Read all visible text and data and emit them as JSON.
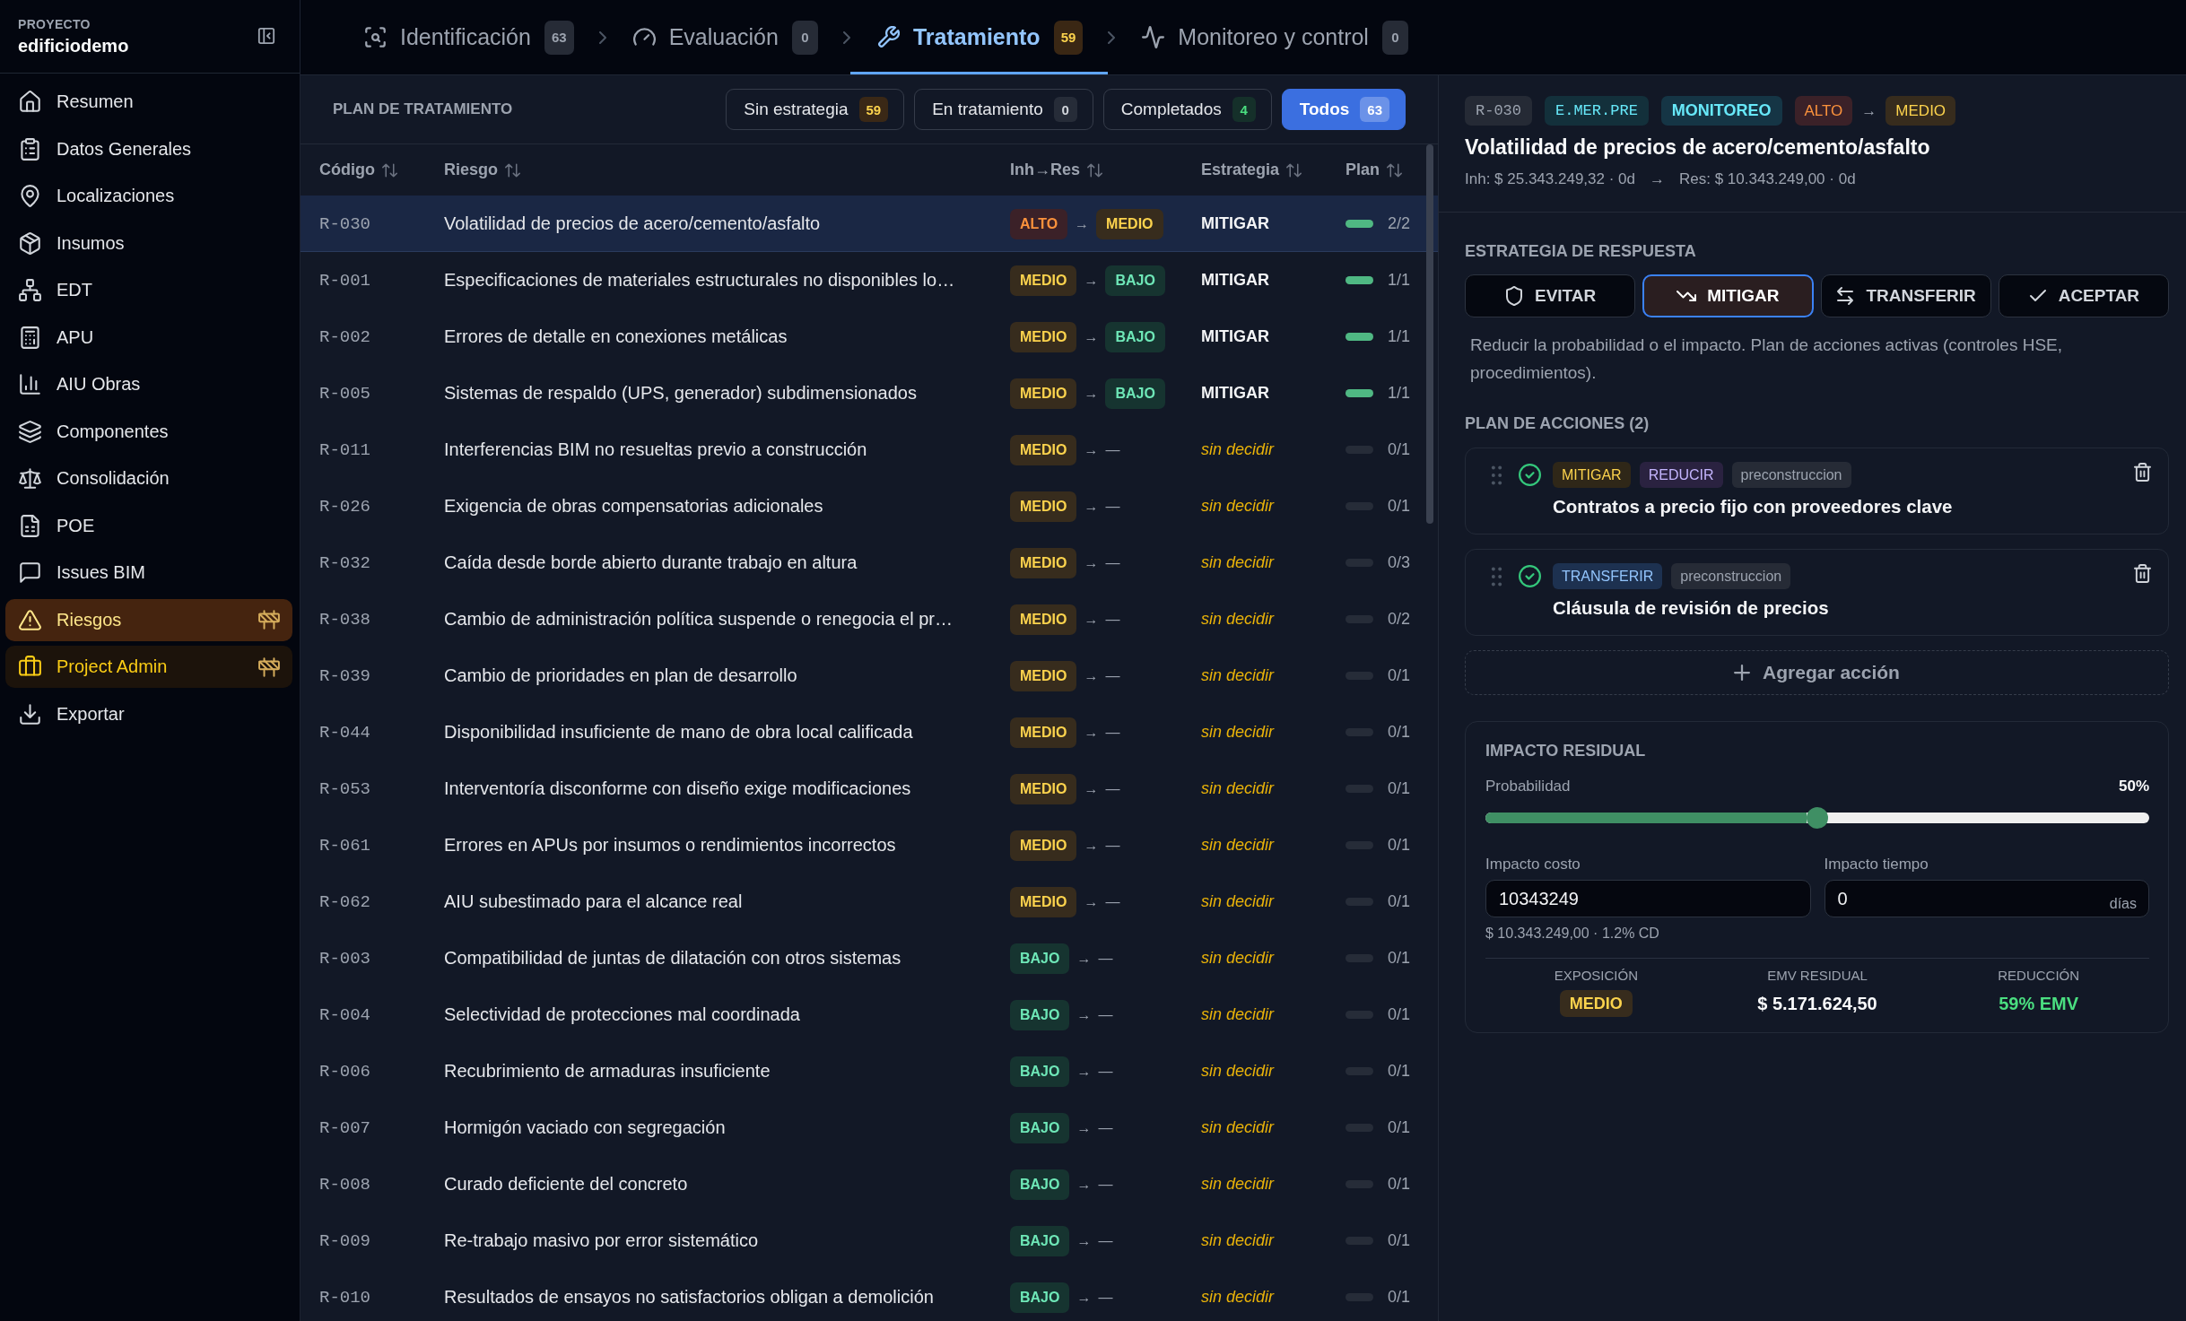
{
  "sidebar": {
    "project_label": "PROYECTO",
    "project_name": "edificiodemo",
    "items": [
      {
        "label": "Resumen",
        "kind": "nav",
        "selected": false,
        "wip": false
      },
      {
        "label": "Datos Generales",
        "kind": "nav",
        "selected": false,
        "wip": false
      },
      {
        "label": "Localizaciones",
        "kind": "nav",
        "selected": false,
        "wip": false
      },
      {
        "label": "Insumos",
        "kind": "nav",
        "selected": false,
        "wip": false
      },
      {
        "label": "EDT",
        "kind": "nav",
        "selected": false,
        "wip": false
      },
      {
        "label": "APU",
        "kind": "nav",
        "selected": false,
        "wip": false
      },
      {
        "label": "AIU Obras",
        "kind": "nav",
        "selected": false,
        "wip": false
      },
      {
        "label": "Componentes",
        "kind": "nav",
        "selected": false,
        "wip": false
      },
      {
        "label": "Consolidación",
        "kind": "nav",
        "selected": false,
        "wip": false
      },
      {
        "label": "POE",
        "kind": "nav",
        "selected": false,
        "wip": false
      },
      {
        "label": "Issues BIM",
        "kind": "nav",
        "selected": false,
        "wip": false
      },
      {
        "label": "Riesgos",
        "kind": "nav",
        "selected": true,
        "wip": true
      },
      {
        "label": "Project Admin",
        "kind": "admin",
        "selected": false,
        "wip": true
      },
      {
        "label": "Exportar",
        "kind": "nav",
        "selected": false,
        "wip": false
      }
    ]
  },
  "tabs": [
    {
      "label": "Identificación",
      "count": "63",
      "selected": false
    },
    {
      "label": "Evaluación",
      "count": "0",
      "selected": false
    },
    {
      "label": "Tratamiento",
      "count": "59",
      "selected": true
    },
    {
      "label": "Monitoreo y control",
      "count": "0",
      "selected": false
    }
  ],
  "plan": {
    "title": "PLAN DE TRATAMIENTO",
    "filters": [
      {
        "label": "Sin estrategia",
        "count": "59",
        "kind": "warning",
        "selected": false
      },
      {
        "label": "En tratamiento",
        "count": "0",
        "kind": "neutral",
        "selected": false
      },
      {
        "label": "Completados",
        "count": "4",
        "kind": "success",
        "selected": false
      },
      {
        "label": "Todos",
        "count": "63",
        "kind": "neutral",
        "selected": true
      }
    ]
  },
  "table": {
    "columns": [
      "Código",
      "Riesgo",
      "Inh→Res",
      "Estrategia",
      "Plan"
    ],
    "rows": [
      {
        "code": "R-030",
        "risk": "Volatilidad de precios de acero/cemento/asfalto",
        "inherent": {
          "label": "ALTO",
          "kind": "high"
        },
        "arrow": "→",
        "residual": {
          "label": "MEDIO",
          "kind": "medium"
        },
        "strategy": {
          "label": "MITIGAR",
          "pending": false
        },
        "plan": {
          "progress": "2/2",
          "level": 1
        },
        "selected": true
      },
      {
        "code": "R-001",
        "risk": "Especificaciones de materiales estructurales no disponibles lo…",
        "inherent": {
          "label": "MEDIO",
          "kind": "medium"
        },
        "arrow": "→",
        "residual": {
          "label": "BAJO",
          "kind": "low"
        },
        "strategy": {
          "label": "MITIGAR",
          "pending": false
        },
        "plan": {
          "progress": "1/1",
          "level": 1
        },
        "selected": false
      },
      {
        "code": "R-002",
        "risk": "Errores de detalle en conexiones metálicas",
        "inherent": {
          "label": "MEDIO",
          "kind": "medium"
        },
        "arrow": "→",
        "residual": {
          "label": "BAJO",
          "kind": "low"
        },
        "strategy": {
          "label": "MITIGAR",
          "pending": false
        },
        "plan": {
          "progress": "1/1",
          "level": 1
        },
        "selected": false
      },
      {
        "code": "R-005",
        "risk": "Sistemas de respaldo (UPS, generador) subdimensionados",
        "inherent": {
          "label": "MEDIO",
          "kind": "medium"
        },
        "arrow": "→",
        "residual": {
          "label": "BAJO",
          "kind": "low"
        },
        "strategy": {
          "label": "MITIGAR",
          "pending": false
        },
        "plan": {
          "progress": "1/1",
          "level": 1
        },
        "selected": false
      },
      {
        "code": "R-011",
        "risk": "Interferencias BIM no resueltas previo a construcción",
        "inherent": {
          "label": "MEDIO",
          "kind": "medium"
        },
        "arrow": "→",
        "residual": {
          "label": "—",
          "kind": "none"
        },
        "strategy": {
          "label": "sin decidir",
          "pending": true
        },
        "plan": {
          "progress": "0/1"
        },
        "selected": false
      },
      {
        "code": "R-026",
        "risk": "Exigencia de obras compensatorias adicionales",
        "inherent": {
          "label": "MEDIO",
          "kind": "medium"
        },
        "arrow": "→",
        "residual": {
          "label": "—",
          "kind": "none"
        },
        "strategy": {
          "label": "sin decidir",
          "pending": true
        },
        "plan": {
          "progress": "0/1"
        },
        "selected": false
      },
      {
        "code": "R-032",
        "risk": "Caída desde borde abierto durante trabajo en altura",
        "inherent": {
          "label": "MEDIO",
          "kind": "medium"
        },
        "arrow": "→",
        "residual": {
          "label": "—",
          "kind": "none"
        },
        "strategy": {
          "label": "sin decidir",
          "pending": true
        },
        "plan": {
          "progress": "0/3"
        },
        "selected": false
      },
      {
        "code": "R-038",
        "risk": "Cambio de administración política suspende o renegocia el pr…",
        "inherent": {
          "label": "MEDIO",
          "kind": "medium"
        },
        "arrow": "→",
        "residual": {
          "label": "—",
          "kind": "none"
        },
        "strategy": {
          "label": "sin decidir",
          "pending": true
        },
        "plan": {
          "progress": "0/2"
        },
        "selected": false
      },
      {
        "code": "R-039",
        "risk": "Cambio de prioridades en plan de desarrollo",
        "inherent": {
          "label": "MEDIO",
          "kind": "medium"
        },
        "arrow": "→",
        "residual": {
          "label": "—",
          "kind": "none"
        },
        "strategy": {
          "label": "sin decidir",
          "pending": true
        },
        "plan": {
          "progress": "0/1"
        },
        "selected": false
      },
      {
        "code": "R-044",
        "risk": "Disponibilidad insuficiente de mano de obra local calificada",
        "inherent": {
          "label": "MEDIO",
          "kind": "medium"
        },
        "arrow": "→",
        "residual": {
          "label": "—",
          "kind": "none"
        },
        "strategy": {
          "label": "sin decidir",
          "pending": true
        },
        "plan": {
          "progress": "0/1"
        },
        "selected": false
      },
      {
        "code": "R-053",
        "risk": "Interventoría disconforme con diseño exige modificaciones",
        "inherent": {
          "label": "MEDIO",
          "kind": "medium"
        },
        "arrow": "→",
        "residual": {
          "label": "—",
          "kind": "none"
        },
        "strategy": {
          "label": "sin decidir",
          "pending": true
        },
        "plan": {
          "progress": "0/1"
        },
        "selected": false
      },
      {
        "code": "R-061",
        "risk": "Errores en APUs por insumos o rendimientos incorrectos",
        "inherent": {
          "label": "MEDIO",
          "kind": "medium"
        },
        "arrow": "→",
        "residual": {
          "label": "—",
          "kind": "none"
        },
        "strategy": {
          "label": "sin decidir",
          "pending": true
        },
        "plan": {
          "progress": "0/1"
        },
        "selected": false
      },
      {
        "code": "R-062",
        "risk": "AIU subestimado para el alcance real",
        "inherent": {
          "label": "MEDIO",
          "kind": "medium"
        },
        "arrow": "→",
        "residual": {
          "label": "—",
          "kind": "none"
        },
        "strategy": {
          "label": "sin decidir",
          "pending": true
        },
        "plan": {
          "progress": "0/1"
        },
        "selected": false
      },
      {
        "code": "R-003",
        "risk": "Compatibilidad de juntas de dilatación con otros sistemas",
        "inherent": {
          "label": "BAJO",
          "kind": "low"
        },
        "arrow": "→",
        "residual": {
          "label": "—",
          "kind": "none"
        },
        "strategy": {
          "label": "sin decidir",
          "pending": true
        },
        "plan": {
          "progress": "0/1"
        },
        "selected": false
      },
      {
        "code": "R-004",
        "risk": "Selectividad de protecciones mal coordinada",
        "inherent": {
          "label": "BAJO",
          "kind": "low"
        },
        "arrow": "→",
        "residual": {
          "label": "—",
          "kind": "none"
        },
        "strategy": {
          "label": "sin decidir",
          "pending": true
        },
        "plan": {
          "progress": "0/1"
        },
        "selected": false
      },
      {
        "code": "R-006",
        "risk": "Recubrimiento de armaduras insuficiente",
        "inherent": {
          "label": "BAJO",
          "kind": "low"
        },
        "arrow": "→",
        "residual": {
          "label": "—",
          "kind": "none"
        },
        "strategy": {
          "label": "sin decidir",
          "pending": true
        },
        "plan": {
          "progress": "0/1"
        },
        "selected": false
      },
      {
        "code": "R-007",
        "risk": "Hormigón vaciado con segregación",
        "inherent": {
          "label": "BAJO",
          "kind": "low"
        },
        "arrow": "→",
        "residual": {
          "label": "—",
          "kind": "none"
        },
        "strategy": {
          "label": "sin decidir",
          "pending": true
        },
        "plan": {
          "progress": "0/1"
        },
        "selected": false
      },
      {
        "code": "R-008",
        "risk": "Curado deficiente del concreto",
        "inherent": {
          "label": "BAJO",
          "kind": "low"
        },
        "arrow": "→",
        "residual": {
          "label": "—",
          "kind": "none"
        },
        "strategy": {
          "label": "sin decidir",
          "pending": true
        },
        "plan": {
          "progress": "0/1"
        },
        "selected": false
      },
      {
        "code": "R-009",
        "risk": "Re-trabajo masivo por error sistemático",
        "inherent": {
          "label": "BAJO",
          "kind": "low"
        },
        "arrow": "→",
        "residual": {
          "label": "—",
          "kind": "none"
        },
        "strategy": {
          "label": "sin decidir",
          "pending": true
        },
        "plan": {
          "progress": "0/1"
        },
        "selected": false
      },
      {
        "code": "R-010",
        "risk": "Resultados de ensayos no satisfactorios obligan a demolición",
        "inherent": {
          "label": "BAJO",
          "kind": "low"
        },
        "arrow": "→",
        "residual": {
          "label": "—",
          "kind": "none"
        },
        "strategy": {
          "label": "sin decidir",
          "pending": true
        },
        "plan": {
          "progress": "0/1"
        },
        "selected": false
      }
    ]
  },
  "detail": {
    "tags": [
      {
        "label": "R-030",
        "kind": "code"
      },
      {
        "label": "E.MER.PRE",
        "kind": "category"
      },
      {
        "label": "MONITOREO",
        "kind": "phase"
      }
    ],
    "inherent": {
      "label": "ALTO",
      "kind": "high"
    },
    "arrow": "→",
    "residual": {
      "label": "MEDIO",
      "kind": "medium"
    },
    "title": "Volatilidad de precios de acero/cemento/asfalto",
    "inherent_summary": "Inh: $ 25.343.249,32 · 0d",
    "summary_arrow": "→",
    "residual_summary": "Res: $ 10.343.249,00 · 0d",
    "strategy": {
      "heading": "ESTRATEGIA DE RESPUESTA",
      "options": [
        {
          "label": "EVITAR",
          "selected": false
        },
        {
          "label": "MITIGAR",
          "selected": true
        },
        {
          "label": "TRANSFERIR",
          "selected": false
        },
        {
          "label": "ACEPTAR",
          "selected": false
        }
      ],
      "description": "Reducir la probabilidad o el impacto. Plan de acciones activas (controles HSE, procedimientos)."
    },
    "actions": {
      "heading": "PLAN DE ACCIONES (2)",
      "items": [
        {
          "done": true,
          "tags": [
            {
              "label": "MITIGAR",
              "kind": "mitigate"
            },
            {
              "label": "REDUCIR",
              "kind": "reduce"
            },
            {
              "label": "preconstruccion",
              "kind": "phase"
            }
          ],
          "title": "Contratos a precio fijo con proveedores clave"
        },
        {
          "done": true,
          "tags": [
            {
              "label": "TRANSFERIR",
              "kind": "transfer"
            },
            {
              "label": "preconstruccion",
              "kind": "phase"
            }
          ],
          "title": "Cláusula de revisión de precios"
        }
      ],
      "add_label": "Agregar acción"
    },
    "residual_impact": {
      "heading": "IMPACTO RESIDUAL",
      "probability_label": "Probabilidad",
      "probability_value": "50%",
      "level": 0.5,
      "cost_label": "Impacto costo",
      "cost_value": "10343249",
      "time_label": "Impacto tiempo",
      "time_value": "0",
      "time_unit": "días",
      "cost_note": "$ 10.343.249,00 · 1.2% CD",
      "stats": [
        {
          "label": "EXPOSICIÓN",
          "value": "MEDIO",
          "kind": "medium"
        },
        {
          "label": "EMV RESIDUAL",
          "value": "$ 5.171.624,50",
          "kind": "amount"
        },
        {
          "label": "REDUCCIÓN",
          "value": "59% EMV",
          "kind": "positive"
        }
      ]
    }
  }
}
